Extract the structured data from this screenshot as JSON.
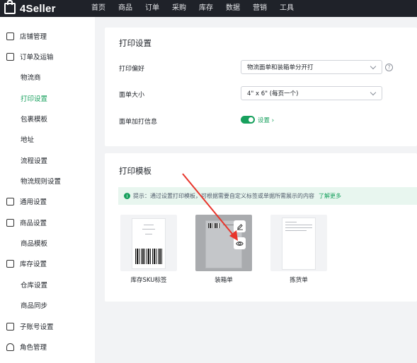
{
  "brand": {
    "name": "4Seller"
  },
  "nav": [
    "首页",
    "商品",
    "订单",
    "采购",
    "库存",
    "数据",
    "营销",
    "工具"
  ],
  "sidebar": {
    "items": [
      {
        "label": "店铺管理",
        "icon": "store-icon",
        "level": "parent"
      },
      {
        "label": "订单及运输",
        "icon": "order-shipping-icon",
        "level": "parent"
      },
      {
        "label": "物流商",
        "level": "child"
      },
      {
        "label": "打印设置",
        "level": "child",
        "active": true
      },
      {
        "label": "包裹模板",
        "level": "child"
      },
      {
        "label": "地址",
        "level": "child"
      },
      {
        "label": "流程设置",
        "level": "child"
      },
      {
        "label": "物流规则设置",
        "level": "child"
      },
      {
        "label": "通用设置",
        "icon": "printer-icon",
        "level": "parent"
      },
      {
        "label": "商品设置",
        "icon": "product-icon",
        "level": "parent"
      },
      {
        "label": "商品模板",
        "level": "child"
      },
      {
        "label": "库存设置",
        "icon": "warehouse-icon",
        "level": "parent"
      },
      {
        "label": "仓库设置",
        "level": "child"
      },
      {
        "label": "商品同步",
        "level": "child"
      },
      {
        "label": "子账号设置",
        "icon": "sub-account-icon",
        "level": "parent"
      },
      {
        "label": "角色管理",
        "icon": "role-icon",
        "level": "parent"
      }
    ]
  },
  "print_settings": {
    "title": "打印设置",
    "preference": {
      "label": "打印偏好",
      "value": "物流面单和装箱单分开打"
    },
    "label_size": {
      "label": "面单大小",
      "value": "4\" x 6\" (每页一个)"
    },
    "extra_info": {
      "label": "面单加打信息",
      "enabled": true,
      "link": "设置 ›"
    }
  },
  "print_templates": {
    "title": "打印模板",
    "tip": {
      "prefix": "提示：通过设置打印模板，可根据需要自定义标签或单据所需展示的内容",
      "more": "了解更多"
    },
    "templates": [
      {
        "label": "库存SKU标签"
      },
      {
        "label": "装箱单",
        "hovered": true
      },
      {
        "label": "拣货单"
      }
    ]
  },
  "accent_color": "#17a05d"
}
